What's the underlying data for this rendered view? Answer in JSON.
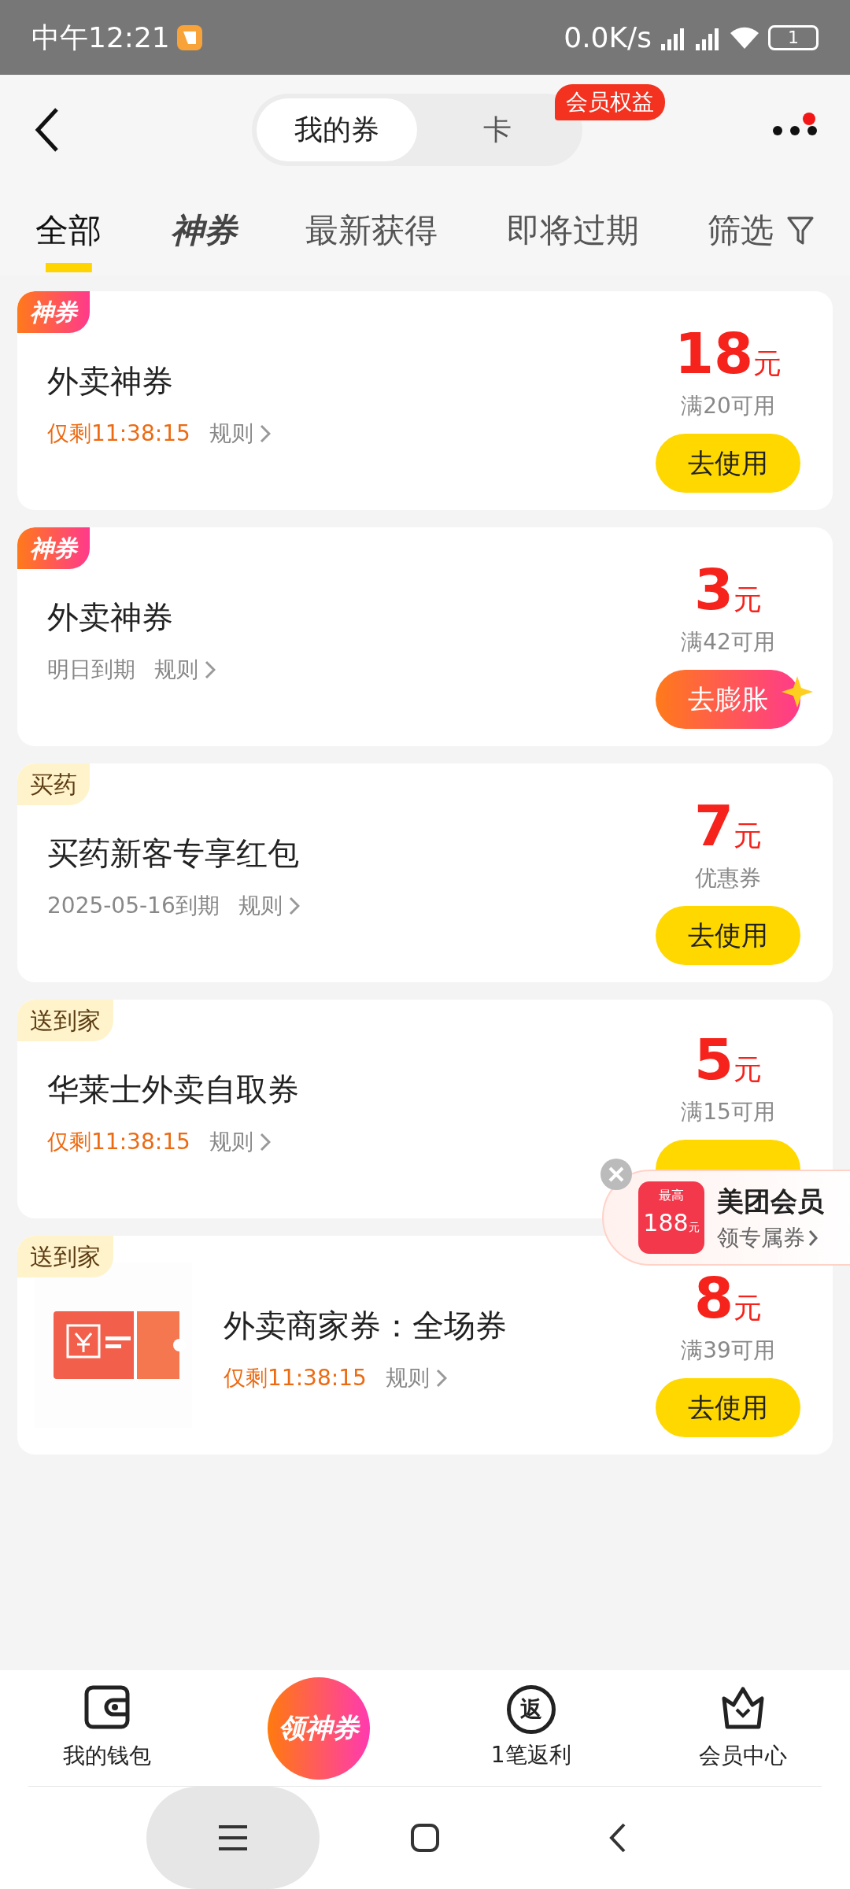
{
  "status_bar": {
    "time": "中午12:21",
    "speed": "0.0K/s",
    "battery": "1"
  },
  "header": {
    "segments": [
      {
        "label": "我的券",
        "selected": true
      },
      {
        "label": "卡",
        "selected": false
      }
    ],
    "badge": "会员权益",
    "notification": true
  },
  "filter_tabs": [
    {
      "label": "全部",
      "kind": "text",
      "selected": true
    },
    {
      "label": "神券",
      "kind": "logo",
      "selected": false
    },
    {
      "label": "最新获得",
      "kind": "text",
      "selected": false
    },
    {
      "label": "即将过期",
      "kind": "text",
      "selected": false
    }
  ],
  "filter": {
    "label": "筛选"
  },
  "coupons": [
    {
      "tag": "神券",
      "kind": "shen",
      "title": "外卖神券",
      "expiry": "仅剩11:38:15",
      "expiry_urgent": true,
      "rules": "规则",
      "amount": "18",
      "unit": "元",
      "condition": "满20可用",
      "button": {
        "label": "去使用",
        "kind": "use"
      },
      "thumbnail": false
    },
    {
      "tag": "神券",
      "kind": "shen",
      "title": "外卖神券",
      "expiry": "明日到期",
      "expiry_urgent": false,
      "rules": "规则",
      "amount": "3",
      "unit": "元",
      "condition": "满42可用",
      "button": {
        "label": "去膨胀",
        "kind": "boost"
      },
      "thumbnail": false
    },
    {
      "tag": "买药",
      "kind": "plain",
      "title": "买药新客专享红包",
      "expiry": "2025-05-16到期",
      "expiry_urgent": false,
      "rules": "规则",
      "amount": "7",
      "unit": "元",
      "condition": "优惠券",
      "button": {
        "label": "去使用",
        "kind": "use"
      },
      "thumbnail": false
    },
    {
      "tag": "送到家",
      "kind": "plain",
      "title": "华莱士外卖自取券",
      "expiry": "仅剩11:38:15",
      "expiry_urgent": true,
      "rules": "规则",
      "amount": "5",
      "unit": "元",
      "condition": "满15可用",
      "button": {
        "kind": "use"
      },
      "thumbnail": false
    },
    {
      "tag": "送到家",
      "kind": "plain",
      "title": "外卖商家券：全场券",
      "expiry": "仅剩11:38:15",
      "expiry_urgent": true,
      "rules": "规则",
      "amount": "8",
      "unit": "元",
      "condition": "满39可用",
      "button": {
        "label": "去使用",
        "kind": "use"
      },
      "thumbnail": true
    }
  ],
  "promo": {
    "top": "最高",
    "amount": "188",
    "unit": "元",
    "title": "美团会员",
    "link": "领专属券"
  },
  "bottom_nav": [
    {
      "label": "我的钱包",
      "kind": "wallet"
    },
    {
      "label": "领神券",
      "kind": "center"
    },
    {
      "label": "1笔返利",
      "kind": "rebate",
      "icon_text": "返"
    },
    {
      "label": "会员中心",
      "kind": "crown"
    }
  ]
}
